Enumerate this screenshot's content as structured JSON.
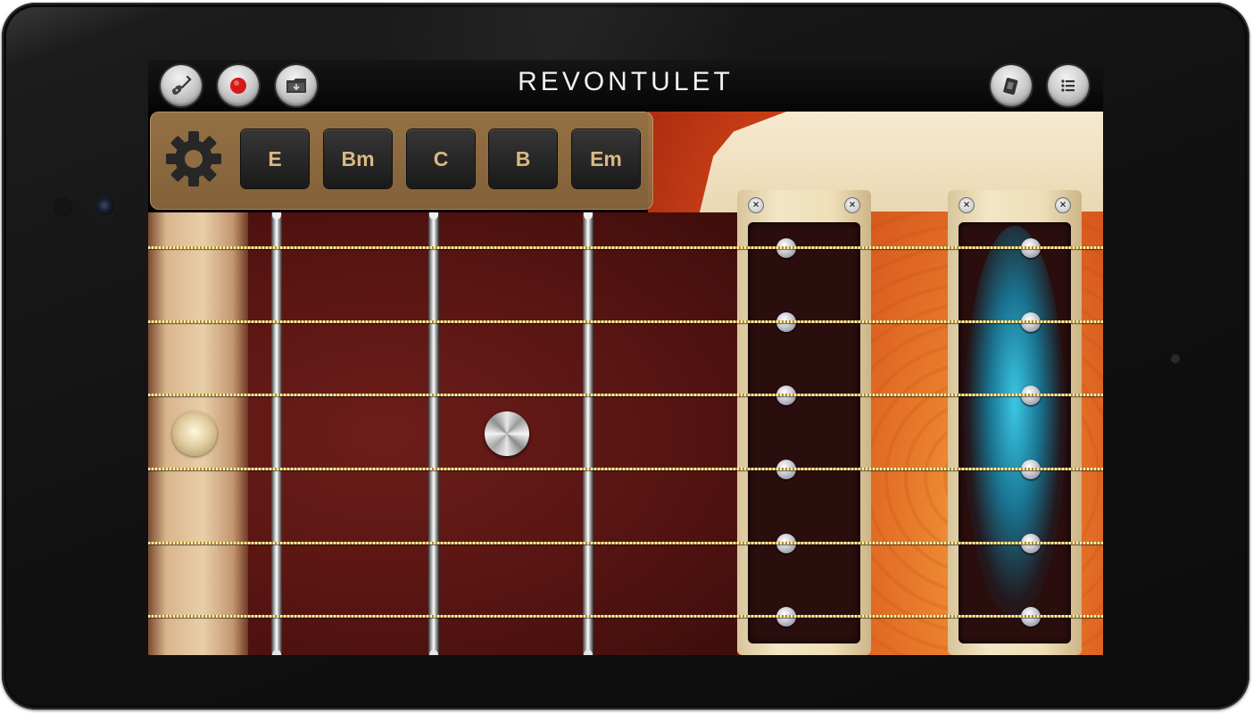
{
  "app": {
    "title": "REVONTULET"
  },
  "toolbar": {
    "left": [
      {
        "name": "guitar-select-icon"
      },
      {
        "name": "record-icon"
      },
      {
        "name": "recordings-folder-icon"
      }
    ],
    "right": [
      {
        "name": "sound-effects-icon"
      },
      {
        "name": "menu-list-icon"
      }
    ]
  },
  "chords": {
    "settings_icon": "gear-icon",
    "buttons": [
      "E",
      "Bm",
      "C",
      "B",
      "Em"
    ]
  },
  "colors": {
    "chord_text": "#e9c88a",
    "record": "#d81818",
    "pickup_glow": "#3cd2f0"
  }
}
